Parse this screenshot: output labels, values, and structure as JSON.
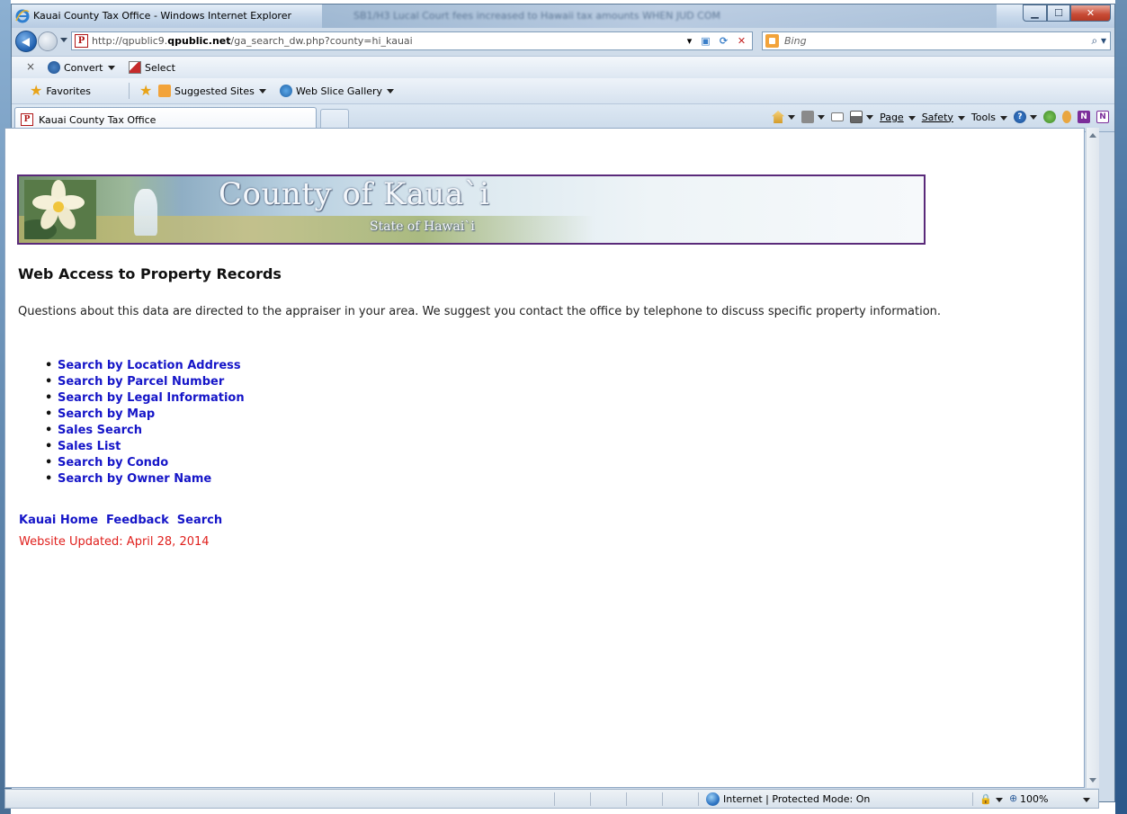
{
  "window": {
    "title": "Kauai County Tax Office - Windows Internet Explorer",
    "background_title_blur": "SB1/H3 Lucal Court fees increased to Hawaii tax amounts WHEN JUD COM"
  },
  "address_bar": {
    "url_prefix": "http://qpublic9.",
    "url_domain": "qpublic.net",
    "url_suffix": "/ga_search_dw.php?county=hi_kauai",
    "search_placeholder": "Bing",
    "search_provider": "Bing"
  },
  "command_bar": {
    "close_label": "×",
    "convert_label": "Convert",
    "select_label": "Select"
  },
  "favorites_bar": {
    "favorites_label": "Favorites",
    "suggested_label": "Suggested Sites",
    "webslice_label": "Web Slice Gallery"
  },
  "tab": {
    "label": "Kauai County Tax Office"
  },
  "tools": {
    "page_label": "Page",
    "safety_label": "Safety",
    "tools_label": "Tools"
  },
  "banner": {
    "title": "County of Kaua`i",
    "subtitle": "State of Hawai`i"
  },
  "page": {
    "heading": "Web Access to Property Records",
    "intro": "Questions about this data are directed to the appraiser in your area.  We suggest you contact the office by telephone to discuss specific property information.",
    "search_links": [
      "Search by Location Address",
      "Search by Parcel Number",
      "Search by Legal Information",
      "Search by Map",
      "Sales Search",
      "Sales List",
      "Search by Condo",
      "Search by Owner Name"
    ],
    "footer_links": [
      "Kauai Home",
      "Feedback",
      "Search"
    ],
    "updated": "Website Updated: April 28, 2014"
  },
  "statusbar": {
    "zone": "Internet | Protected Mode: On",
    "zoom": "100%"
  },
  "colors": {
    "link": "#1515c8",
    "updated_text": "#e0201d",
    "banner_border": "#5a2a7a"
  }
}
